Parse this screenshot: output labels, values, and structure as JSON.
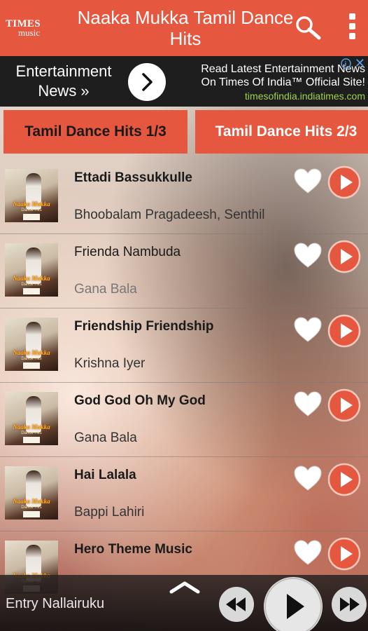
{
  "header": {
    "logo_line1": "TIMES",
    "logo_line2": "music",
    "title": "Naaka Mukka Tamil Dance Hits"
  },
  "ad": {
    "left_text": "Entertainment News »",
    "right_line1": "Read Latest Entertainment News",
    "right_line2": "On Times Of India™ Official Site!",
    "url": "timesofindia.indiatimes.com"
  },
  "tabs": [
    {
      "label": "Tamil Dance Hits 1/3",
      "active": true
    },
    {
      "label": "Tamil Dance Hits 2/3",
      "active": false
    }
  ],
  "thumb": {
    "title": "Naaka Mukka",
    "subtitle": "Dance Hits"
  },
  "songs": [
    {
      "title": "Ettadi Bassukkulle",
      "artist": "Bhoobalam Pragadeesh, Senthil"
    },
    {
      "title": "Frienda Nambuda",
      "artist": "Gana Bala"
    },
    {
      "title": "Friendship Friendship",
      "artist": "Krishna Iyer"
    },
    {
      "title": "God God Oh My God",
      "artist": "Gana Bala"
    },
    {
      "title": "Hai Lalala",
      "artist": "Bappi Lahiri"
    },
    {
      "title": "Hero Theme Music",
      "artist": ""
    }
  ],
  "player": {
    "now_playing": "Entry Nallairuku"
  },
  "colors": {
    "brand": "#e5573f",
    "ad_background": "#1e1e1e",
    "ad_url": "#9fd44a"
  },
  "icons": [
    "search-icon",
    "overflow-menu-icon",
    "chevron-right-icon",
    "adchoices-icon",
    "close-icon",
    "heart-icon",
    "play-icon",
    "chevron-up-icon",
    "rewind-icon",
    "fast-forward-icon"
  ]
}
